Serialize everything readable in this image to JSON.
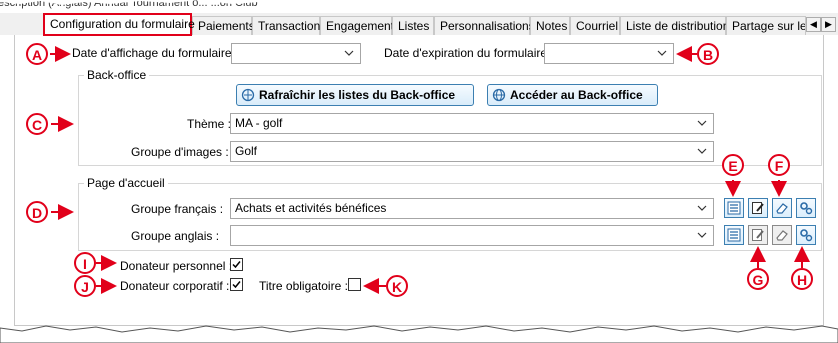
{
  "window": {
    "strip_text": "escription (Anglais)   Annual Tournament o... ...on Club"
  },
  "tabs": [
    {
      "label": "Configuration du formulaire"
    },
    {
      "label": "Paiements"
    },
    {
      "label": "Transaction"
    },
    {
      "label": "Engagement"
    },
    {
      "label": "Listes"
    },
    {
      "label": "Personnalisations"
    },
    {
      "label": "Notes"
    },
    {
      "label": "Courriel"
    },
    {
      "label": "Liste de distribution"
    },
    {
      "label": "Partage sur les"
    }
  ],
  "form": {
    "display_date_label": "Date d'affichage du formulaire :",
    "display_date_value": "",
    "expiry_date_label": "Date d'expiration du formulaire :",
    "expiry_date_value": ""
  },
  "backoffice": {
    "title": "Back-office",
    "refresh_label": "Rafraîchir les listes du Back-office",
    "access_label": "Accéder au Back-office",
    "theme_label": "Thème :",
    "theme_value": "MA - golf",
    "images_label": "Groupe d'images :",
    "images_value": "Golf"
  },
  "homepage": {
    "title": "Page d'accueil",
    "french_label": "Groupe français :",
    "french_value": "Achats et activités bénéfices",
    "english_label": "Groupe anglais :",
    "english_value": ""
  },
  "options": {
    "personal_label": "Donateur personnel :",
    "personal_checked": true,
    "corporate_label": "Donateur corporatif :",
    "corporate_checked": true,
    "title_required_label": "Titre obligatoire :",
    "title_required_checked": false
  },
  "annotations": [
    "A",
    "B",
    "C",
    "D",
    "E",
    "F",
    "G",
    "H",
    "I",
    "J",
    "K"
  ],
  "colors": {
    "annotation": "#e1001a",
    "button_border": "#3c7fb1"
  },
  "icons": [
    "list-icon",
    "edit-page-icon",
    "eraser-icon",
    "settings-icon",
    "refresh-globe-icon",
    "globe-icon",
    "chevron-down-icon"
  ]
}
